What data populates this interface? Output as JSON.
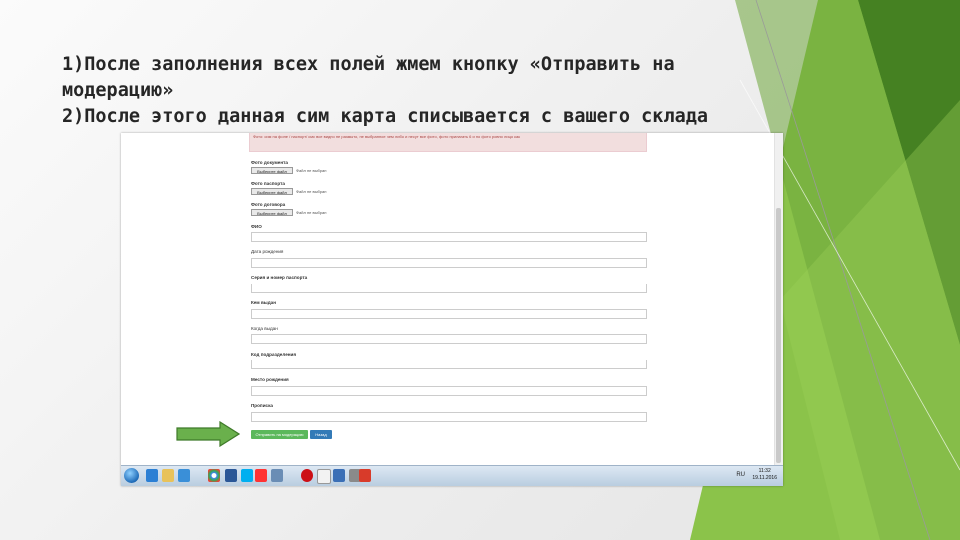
{
  "slide": {
    "line1": "1)После заполнения всех полей жмем кнопку «Отправить на модерацию»",
    "line2": "2)После этого данная сим карта списывается с вашего склада"
  },
  "colors": {
    "accent_green": "#8bc34a",
    "dark_green": "#3d7a1e",
    "arrow_green": "#6ab04c",
    "submit_green": "#5cb85c",
    "back_blue": "#337ab7"
  },
  "form": {
    "alert_text": "Фото: сим на фоне / паспорт/ смс все видно не размыто, не выбранное чем либо и несут все фото, фото прилагать 6 и по фото ровно лицо как",
    "photo1_label": "Фото документа",
    "photo1_button": "Выберите файл",
    "photo1_status": "Файл не выбран",
    "photo2_label": "Фото паспорта",
    "photo2_button": "Выберите файл",
    "photo2_status": "Файл не выбран",
    "photo3_label": "Фото договора",
    "photo3_button": "Выберите файл",
    "photo3_status": "Файл не выбран",
    "fio_label": "ФИО",
    "birthdate_label": "Дата рождения",
    "passport_label": "Серия и номер паспорта",
    "issuedby_label": "Кем выдан",
    "issuedate_label": "Когда выдан",
    "deptcode_label": "Код подразделения",
    "birthplace_label": "Место рождения",
    "address_label": "Прописка",
    "submit_button": "Отправить на модерацию",
    "back_button": "Назад"
  },
  "taskbar": {
    "icons": [
      "start-orb",
      "ie-icon",
      "folder-icon",
      "media-icon",
      "chrome-icon",
      "word-icon",
      "skype-icon",
      "yandex-icon",
      "app-icon",
      "opera-icon",
      "file-icon",
      "app2-icon",
      "antivirus-icon",
      "pdf-icon"
    ],
    "tray": "RU",
    "time": "11:32",
    "date": "19.11.2016"
  }
}
